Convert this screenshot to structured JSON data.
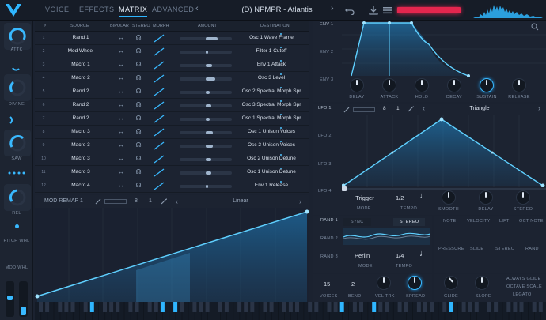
{
  "topbar": {
    "tabs": [
      "VOICE",
      "EFFECTS",
      "MATRIX",
      "ADVANCED"
    ],
    "active_tab": "MATRIX",
    "preset_name": "(D) NPMPR - Atlantis",
    "prev_arrow": "‹",
    "next_arrow": "›"
  },
  "sidebar": {
    "knobs": [
      {
        "label": "ATTK"
      },
      {
        "label": "DIVINE"
      },
      {
        "label": "SAW"
      },
      {
        "label": "REL"
      }
    ],
    "labels": {
      "pitch": "PITCH WHL",
      "mod": "MOD WHL"
    }
  },
  "matrix": {
    "headers": {
      "num": "#",
      "source": "SOURCE",
      "bipolar": "BIPOLAR",
      "stereo": "STEREO",
      "morph": "MORPH",
      "amount": "AMOUNT",
      "destination": "DESTINATION"
    },
    "rows": [
      {
        "num": "1",
        "source": "Rand 1",
        "amount": 0.72,
        "destination": "Osc 1 Wave Frame"
      },
      {
        "num": "2",
        "source": "Mod Wheel",
        "amount": 0.55,
        "destination": "Filter 1 Cutoff"
      },
      {
        "num": "3",
        "source": "Macro 1",
        "amount": 0.62,
        "destination": "Env 1 Attack"
      },
      {
        "num": "4",
        "source": "Macro 2",
        "amount": 0.68,
        "destination": "Osc 3 Level"
      },
      {
        "num": "5",
        "source": "Rand 2",
        "amount": 0.58,
        "destination": "Osc 2 Spectral Morph Spr"
      },
      {
        "num": "6",
        "source": "Rand 2",
        "amount": 0.6,
        "destination": "Osc 3 Spectral Morph Spr"
      },
      {
        "num": "7",
        "source": "Rand 2",
        "amount": 0.57,
        "destination": "Osc 1 Spectral Morph Spr"
      },
      {
        "num": "8",
        "source": "Macro 3",
        "amount": 0.63,
        "destination": "Osc 1 Unison Voices"
      },
      {
        "num": "9",
        "source": "Macro 3",
        "amount": 0.63,
        "destination": "Osc 2 Unison Voices"
      },
      {
        "num": "10",
        "source": "Macro 3",
        "amount": 0.6,
        "destination": "Osc 2 Unison Detune"
      },
      {
        "num": "11",
        "source": "Macro 3",
        "amount": 0.6,
        "destination": "Osc 1 Unison Detune"
      },
      {
        "num": "12",
        "source": "Macro 4",
        "amount": 0.55,
        "destination": "Env 1 Release"
      }
    ]
  },
  "remap": {
    "title": "MOD REMAP 1",
    "grid_a": "8",
    "grid_b": "1",
    "curve": "Linear"
  },
  "env": {
    "labels": [
      "ENV 1",
      "ENV 2",
      "ENV 3"
    ],
    "knobs": [
      "DELAY",
      "ATTACK",
      "HOLD",
      "DECAY",
      "SUSTAIN",
      "RELEASE"
    ]
  },
  "lfo": {
    "labels": [
      "LFO 1",
      "LFO 2",
      "LFO 3",
      "LFO 4"
    ],
    "grid_a": "8",
    "grid_b": "1",
    "shape": "Triangle",
    "trigger": "Trigger",
    "mode_label": "MODE",
    "tempo": "1/2",
    "tempo_label": "TEMPO",
    "knobs": [
      "SMOOTH",
      "DELAY",
      "STEREO"
    ]
  },
  "rand": {
    "labels": [
      "RAND 1",
      "RAND 2",
      "RAND 3"
    ],
    "sync": "SYNC",
    "stereo": "STEREO",
    "mode": "Perlin",
    "mode_label": "MODE",
    "tempo": "1/4",
    "tempo_label": "TEMPO"
  },
  "keytrack": {
    "items": [
      "NOTE",
      "VELOCITY",
      "LIFT",
      "OCT NOTE",
      "PRESSURE",
      "SLIDE",
      "STEREO",
      "RAND"
    ]
  },
  "voice": {
    "voices": "15",
    "voices_label": "VOICES",
    "bend": "2",
    "bend_label": "BEND",
    "veltrk_label": "VEL TRK",
    "spread_label": "SPREAD",
    "glide_label": "GLIDE",
    "slope_label": "SLOPE",
    "options": [
      "ALWAYS GLIDE",
      "OCTAVE SCALE",
      "LEGATO"
    ]
  },
  "colors": {
    "accent": "#2fb6ff",
    "red": "#e3264e",
    "bg": "#1b2230"
  }
}
